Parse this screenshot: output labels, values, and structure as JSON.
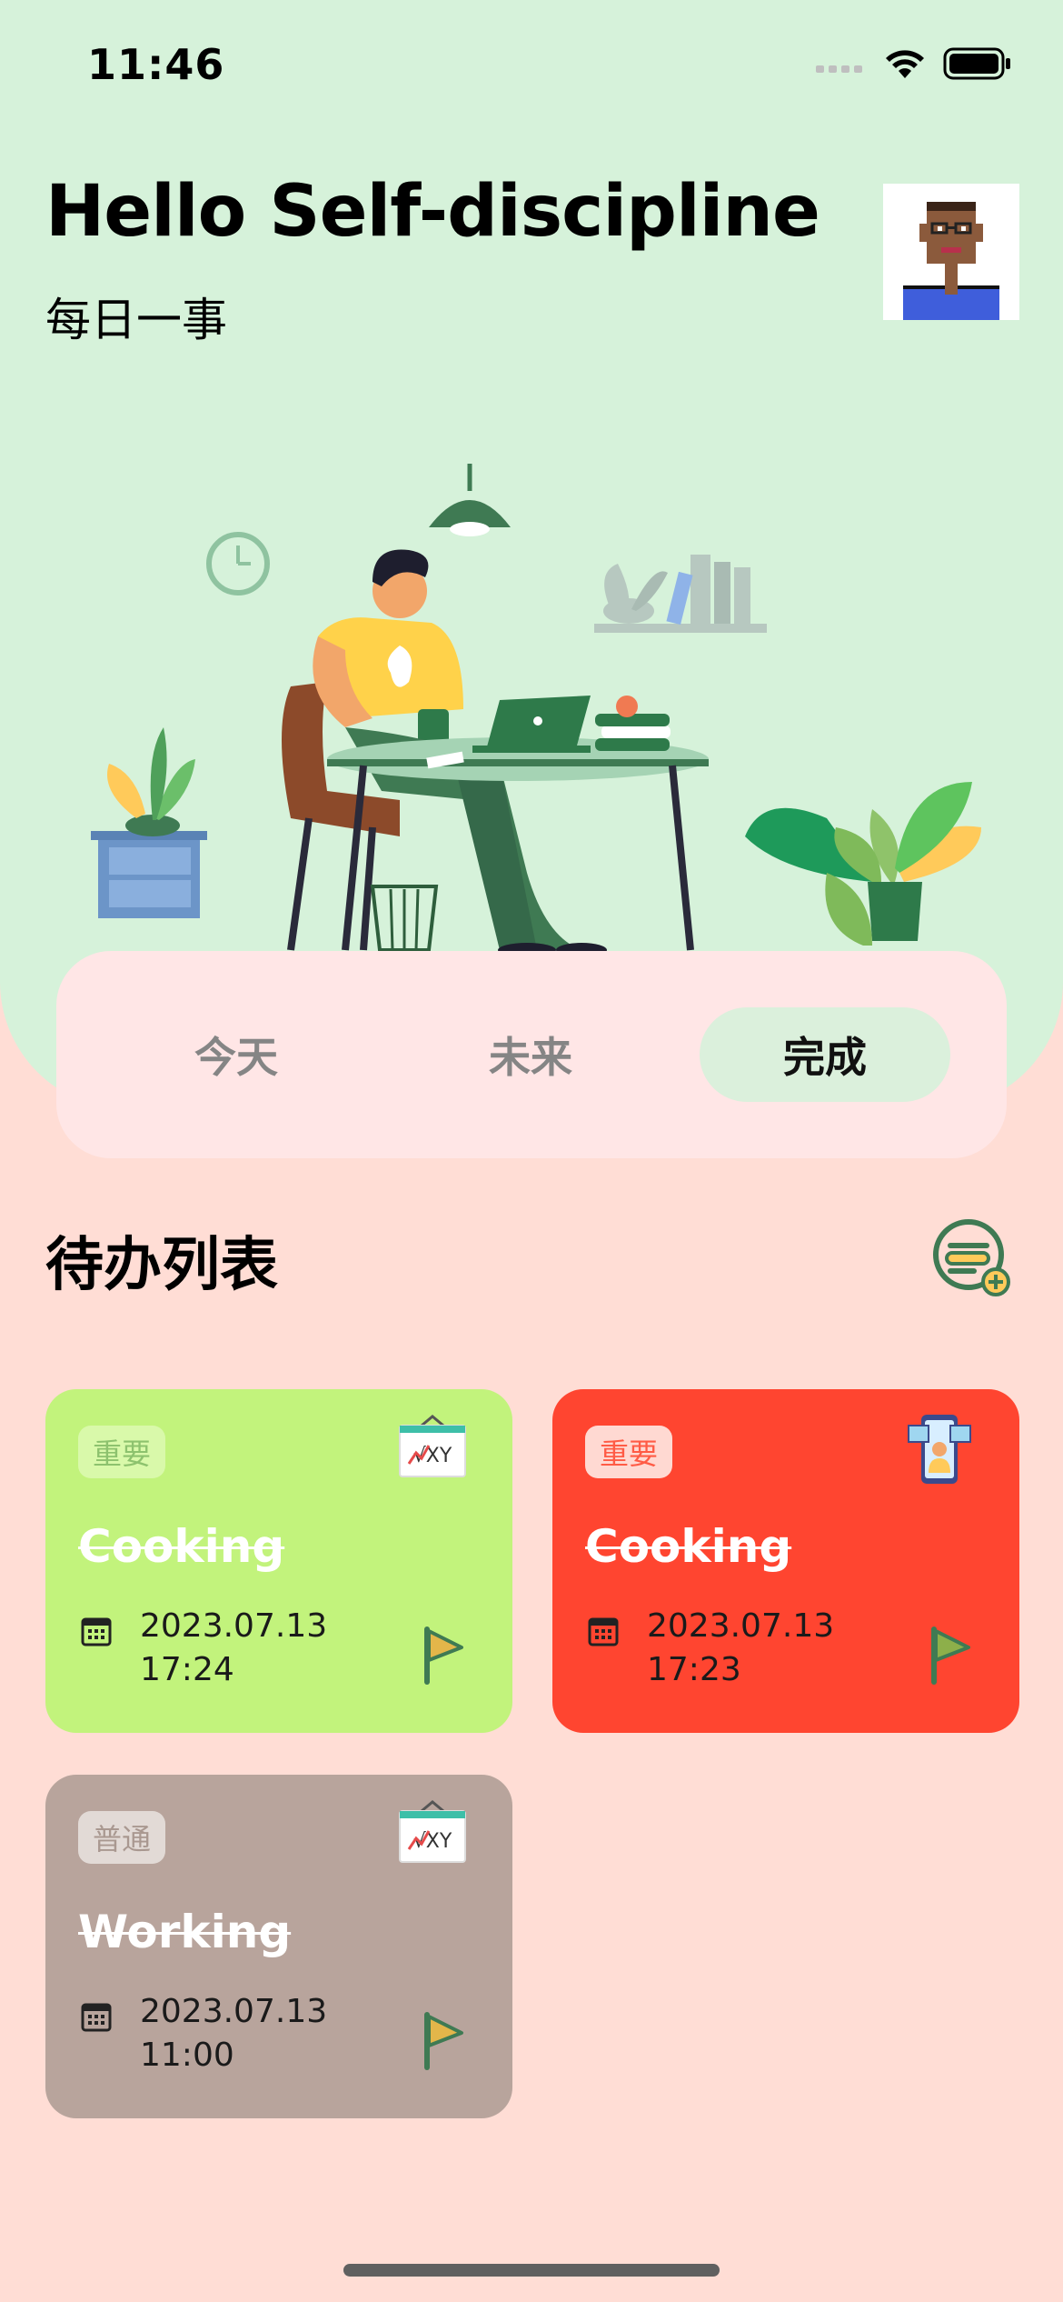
{
  "status": {
    "time": "11:46"
  },
  "header": {
    "title": "Hello Self-discipline",
    "subtitle": "每日一事"
  },
  "tabs": [
    {
      "label": "今天",
      "active": false
    },
    {
      "label": "未来",
      "active": false
    },
    {
      "label": "完成",
      "active": true
    }
  ],
  "section": {
    "title": "待办列表"
  },
  "tasks": [
    {
      "badge": "重要",
      "title": "Cooking",
      "date": "2023.07.13",
      "time": "17:24",
      "color": "#C2F37C",
      "icon": "formula-board-icon"
    },
    {
      "badge": "重要",
      "title": "Cooking",
      "date": "2023.07.13",
      "time": "17:23",
      "color": "#FF4530",
      "icon": "phone-profile-icon"
    },
    {
      "badge": "普通",
      "title": "Working",
      "date": "2023.07.13",
      "time": "11:00",
      "color": "#B8A49C",
      "icon": "formula-board-icon"
    }
  ],
  "colors": {
    "hero": "#D6F2DA",
    "page": "#FFDDD5",
    "accent_green": "#4A8C4E"
  }
}
